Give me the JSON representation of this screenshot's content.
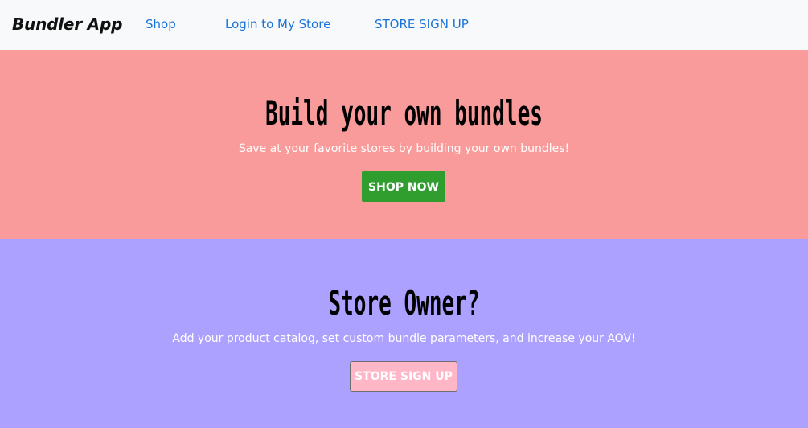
{
  "navbar": {
    "brand": "Bundler App",
    "links": [
      "Shop",
      "Login to My Store",
      "STORE SIGN UP"
    ]
  },
  "hero": {
    "title": "Build your own bundles",
    "subtitle": "Save at your favorite stores by building your own bundles!",
    "button_label": "SHOP NOW",
    "background_color": "#f99b9a",
    "button_color": "#2f9e2f"
  },
  "owner": {
    "title": "Store Owner?",
    "subtitle": "Add your product catalog, set custom bundle parameters, and increase your AOV!",
    "button_label": "STORE SIGN UP",
    "background_color": "#ada1ff",
    "button_color": "#ffb6c6"
  },
  "colors": {
    "link": "#1a73d9",
    "navbar_bg": "#f8f9fa"
  }
}
